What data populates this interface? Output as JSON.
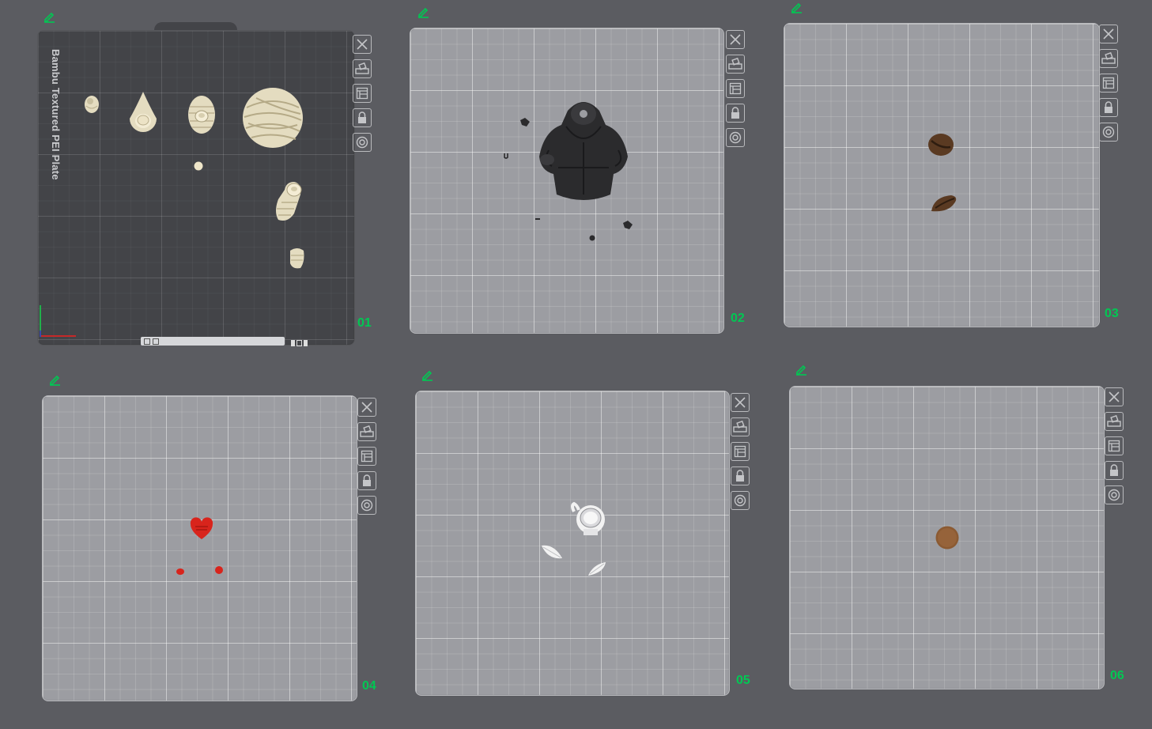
{
  "plates": [
    {
      "label": "01",
      "name": "Bambu Textured PEI Plate",
      "status_text": "",
      "models": [
        "donut-model",
        "teardrop-model",
        "mummy-figure-model",
        "mummy-ball-model",
        "peg-model",
        "mummy-lying-model",
        "mummy-foot-model"
      ]
    },
    {
      "label": "02",
      "models": [
        "robe-figure-model",
        "small-part-model"
      ]
    },
    {
      "label": "03",
      "models": [
        "coffee-bean-model",
        "coffee-bean-model"
      ]
    },
    {
      "label": "04",
      "models": [
        "heart-model",
        "small-part-model"
      ]
    },
    {
      "label": "05",
      "models": [
        "coffee-cup-model",
        "leaf-model"
      ]
    },
    {
      "label": "06",
      "models": [
        "coin-model"
      ]
    }
  ],
  "toolbar_icons": [
    "close-icon",
    "auto-orient-icon",
    "arrange-icon",
    "lock-icon",
    "settings-icon"
  ],
  "colors": {
    "background": "#5b5c61",
    "plate_label": "#00c853",
    "edit_icon": "#00c853",
    "bed_light": "#9c9da2",
    "bed_dark": "#434448",
    "model_cream": "#e4dcc0",
    "model_black": "#2b2b2d",
    "model_brown": "#5a3a22",
    "model_red": "#d8241c",
    "model_white": "#f2f2f2",
    "coin_brown": "#8b5a32"
  }
}
